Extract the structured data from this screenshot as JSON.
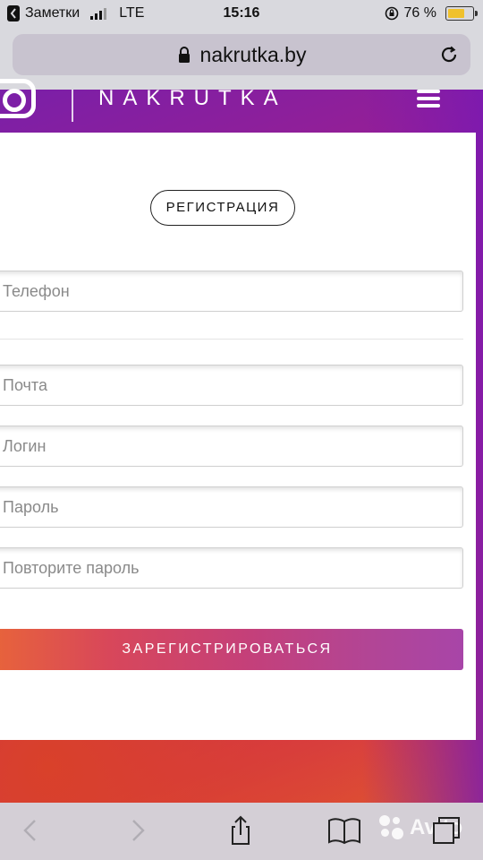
{
  "status_bar": {
    "back_app": "Заметки",
    "network": "LTE",
    "time": "15:16",
    "battery_percent": "76 %",
    "battery_level": 0.76,
    "icons": [
      "chevron-left-icon",
      "signal-icon",
      "rotation-lock-icon",
      "battery-icon"
    ]
  },
  "browser": {
    "url": "nakrutka.by",
    "icons": [
      "padlock-icon",
      "reload-icon"
    ]
  },
  "site": {
    "brand": "NAKRUTKA",
    "icons": [
      "instagram-logo-icon",
      "hamburger-menu-icon"
    ]
  },
  "form": {
    "title": "РЕГИСТРАЦИЯ",
    "fields": {
      "phone": "Телефон",
      "email": "Почта",
      "login": "Логин",
      "password": "Пароль",
      "password_repeat": "Повторите пароль"
    },
    "submit": "ЗАРЕГИСТРИРОВАТЬСЯ"
  },
  "toolbar": {
    "watermark": "Avito",
    "icons": [
      "back-arrow-icon",
      "forward-arrow-icon",
      "share-icon",
      "bookmarks-icon",
      "tabs-icon"
    ]
  },
  "colors": {
    "gradient_purple": "#7a1fa8",
    "gradient_red": "#d9412a",
    "battery_yellow": "#f0c12d"
  }
}
